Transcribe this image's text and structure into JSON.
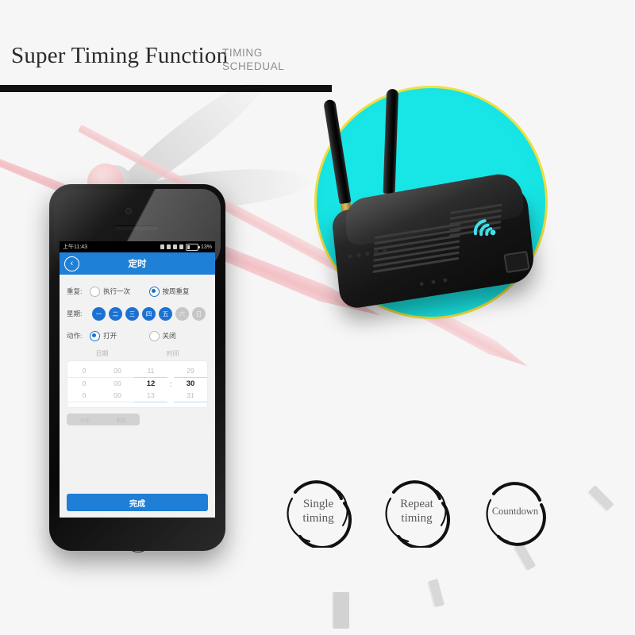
{
  "header": {
    "title": "Super Timing Function",
    "subtitle_line1": "TIMING",
    "subtitle_line2": "SCHEDUAL"
  },
  "phone": {
    "status_bar": {
      "time": "上午11:43",
      "battery_percent": "13%"
    },
    "nav": {
      "back_icon": "chevron-left-icon",
      "title": "定时"
    },
    "form": {
      "repeat": {
        "label": "重复:",
        "options": [
          {
            "text": "执行一次",
            "selected": false
          },
          {
            "text": "按周重复",
            "selected": true
          }
        ]
      },
      "week": {
        "label": "星期:",
        "days": [
          {
            "text": "一",
            "on": true
          },
          {
            "text": "二",
            "on": true
          },
          {
            "text": "三",
            "on": true
          },
          {
            "text": "四",
            "on": true
          },
          {
            "text": "五",
            "on": true
          },
          {
            "text": "六",
            "on": false
          },
          {
            "text": "日",
            "on": false
          }
        ]
      },
      "action": {
        "label": "动作:",
        "options": [
          {
            "text": "打开",
            "selected": true
          },
          {
            "text": "关闭",
            "selected": false
          }
        ]
      },
      "picker_headers": {
        "date": "日期",
        "time": "时间"
      },
      "picker": {
        "date_col1": {
          "prev": "0",
          "current": "0",
          "next": "0"
        },
        "date_col2": {
          "prev": "00",
          "current": "00",
          "next": "00"
        },
        "hour": {
          "prev": "11",
          "current": "12",
          "next": "13"
        },
        "separator": ":",
        "minute": {
          "prev": "29",
          "current": "30",
          "next": "31"
        }
      },
      "year_pill": {
        "left": "今年",
        "right": "明年"
      },
      "submit_label": "完成"
    }
  },
  "product": {
    "logo_icon": "wifi-icon",
    "circle_color": "#18E6E6",
    "ring_color": "#F2E23C"
  },
  "badges": [
    {
      "line1": "Single",
      "line2": "timing"
    },
    {
      "line1": "Repeat",
      "line2": "timing"
    },
    {
      "line1": "Countdown",
      "line2": ""
    }
  ]
}
